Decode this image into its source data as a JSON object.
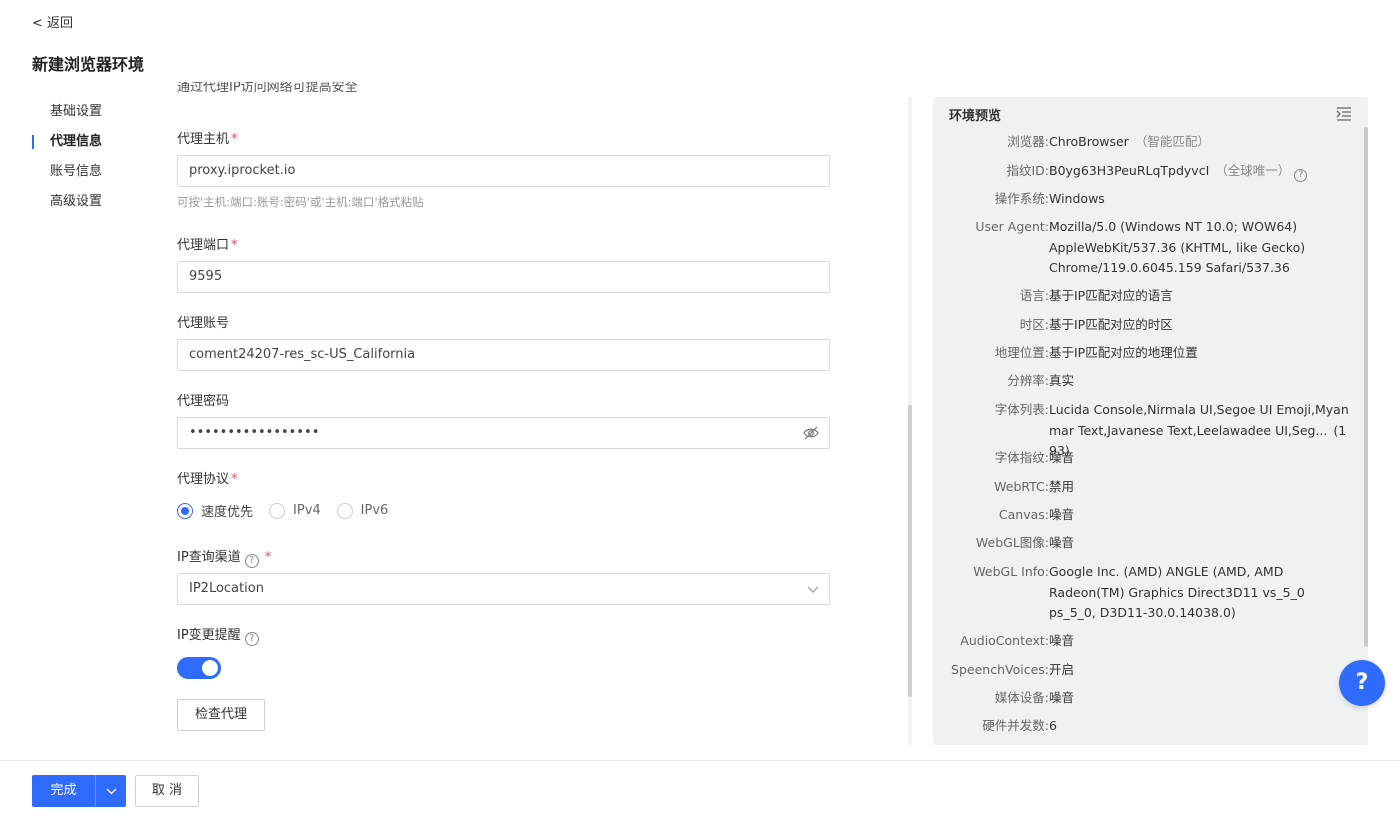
{
  "back_label": "< 返回",
  "page_title": "新建浏览器环境",
  "side_nav": [
    {
      "label": "基础设置"
    },
    {
      "label": "代理信息"
    },
    {
      "label": "账号信息"
    },
    {
      "label": "高级设置"
    }
  ],
  "form": {
    "cut_text": "通过代理IP访问网络可提高安全",
    "host": {
      "label": "代理主机",
      "required": "*",
      "value": "proxy.iprocket.io",
      "hint": "可按'主机:端口:账号:密码'或'主机:端口'格式粘贴"
    },
    "port": {
      "label": "代理端口",
      "required": "*",
      "value": "9595"
    },
    "account": {
      "label": "代理账号",
      "value": "coment24207-res_sc-US_California"
    },
    "password": {
      "label": "代理密码",
      "value": "•••••••••••••••••"
    },
    "protocol": {
      "label": "代理协议",
      "required": "*",
      "options": [
        "速度优先",
        "IPv4",
        "IPv6"
      ],
      "selected": "速度优先"
    },
    "ip_channel": {
      "label": "IP查询渠道",
      "required": "*",
      "value": "IP2Location"
    },
    "ip_change": {
      "label": "IP变更提醒",
      "enabled": true
    },
    "check_button": "检查代理"
  },
  "preview": {
    "title": "环境预览",
    "rows": [
      {
        "key": "浏览器:",
        "value": "ChroBrowser",
        "sub": "（智能匹配）"
      },
      {
        "key": "指纹ID:",
        "value": "B0yg63H3PeuRLqTpdyvcI",
        "sub": "（全球唯一）"
      },
      {
        "key": "操作系统:",
        "value": "Windows"
      },
      {
        "key": "User Agent:",
        "value": "Mozilla/5.0 (Windows NT 10.0; WOW64) AppleWebKit/537.36 (KHTML, like Gecko) Chrome/119.0.6045.159 Safari/537.36"
      },
      {
        "key": "语言:",
        "value": "基于IP匹配对应的语言"
      },
      {
        "key": "时区:",
        "value": "基于IP匹配对应的时区"
      },
      {
        "key": "地理位置:",
        "value": "基于IP匹配对应的地理位置"
      },
      {
        "key": "分辨率:",
        "value": "真实"
      },
      {
        "key": "字体列表:",
        "value": "Lucida Console,Nirmala UI,Segoe UI Emoji,Myanmar Text,Javanese Text,Leelawadee UI,Seg...",
        "sub": "(193)"
      },
      {
        "key": "字体指纹:",
        "value": "噪音"
      },
      {
        "key": "WebRTC:",
        "value": "禁用"
      },
      {
        "key": "Canvas:",
        "value": "噪音"
      },
      {
        "key": "WebGL图像:",
        "value": "噪音"
      },
      {
        "key": "WebGL Info:",
        "value": "Google Inc. (AMD) ANGLE (AMD, AMD Radeon(TM) Graphics Direct3D11 vs_5_0 ps_5_0, D3D11-30.0.14038.0)"
      },
      {
        "key": "AudioContext:",
        "value": "噪音"
      },
      {
        "key": "SpeenchVoices:",
        "value": "开启"
      },
      {
        "key": "媒体设备:",
        "value": "噪音"
      },
      {
        "key": "硬件并发数:",
        "value": "6"
      }
    ]
  },
  "footer": {
    "done": "完成",
    "cancel": "取 消"
  },
  "help": "?",
  "colors": {
    "accent": "#2f6bff",
    "required": "#e34d59",
    "panel_bg": "#f0f1f3"
  }
}
